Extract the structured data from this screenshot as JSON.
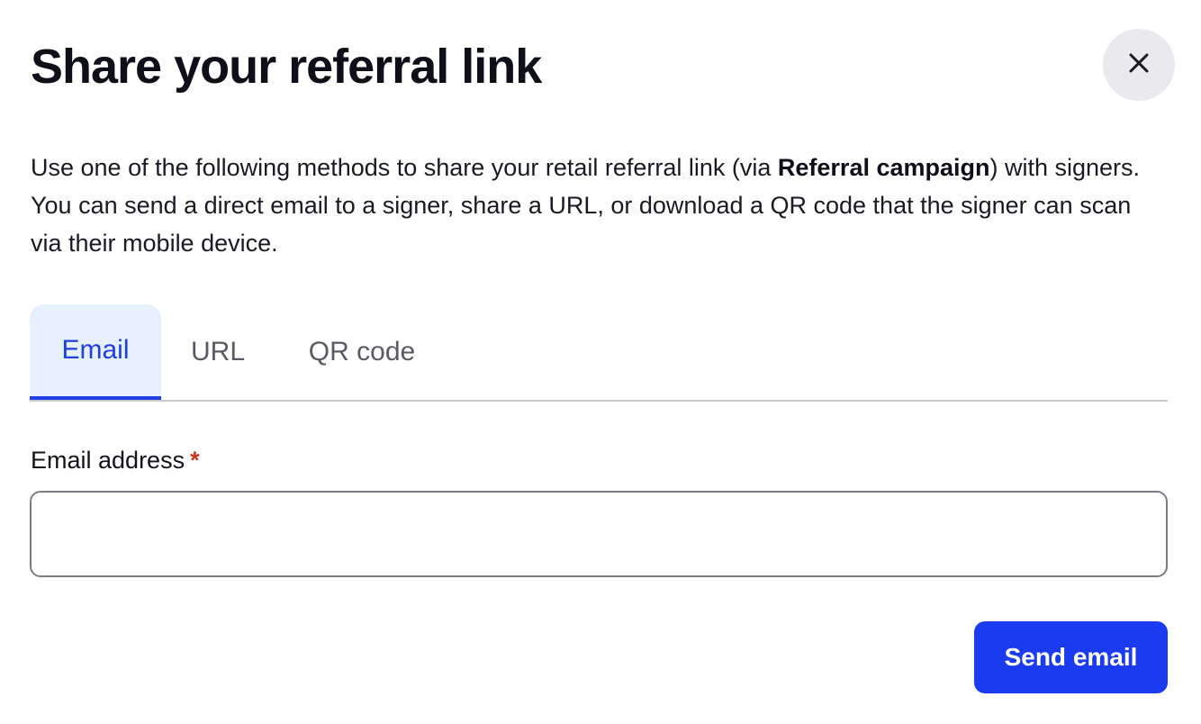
{
  "dialog": {
    "title": "Share your referral link",
    "close_icon": "close-icon",
    "description": {
      "before": "Use one of the following methods to share your retail referral link (via ",
      "bold": "Referral campaign",
      "after": ") with signers. You can send a direct email to a signer, share a URL, or download a QR code that the signer can scan via their mobile device."
    },
    "tabs": [
      {
        "label": "Email",
        "active": true
      },
      {
        "label": "URL",
        "active": false
      },
      {
        "label": "QR code",
        "active": false
      }
    ],
    "email_field": {
      "label": "Email address",
      "required_marker": "*",
      "value": "",
      "placeholder": ""
    },
    "send_button_label": "Send email"
  },
  "colors": {
    "accent": "#1b3bf0",
    "tab_active_bg": "#e7f0fd",
    "required": "#c8351e",
    "close_bg": "#e9e9ee"
  }
}
